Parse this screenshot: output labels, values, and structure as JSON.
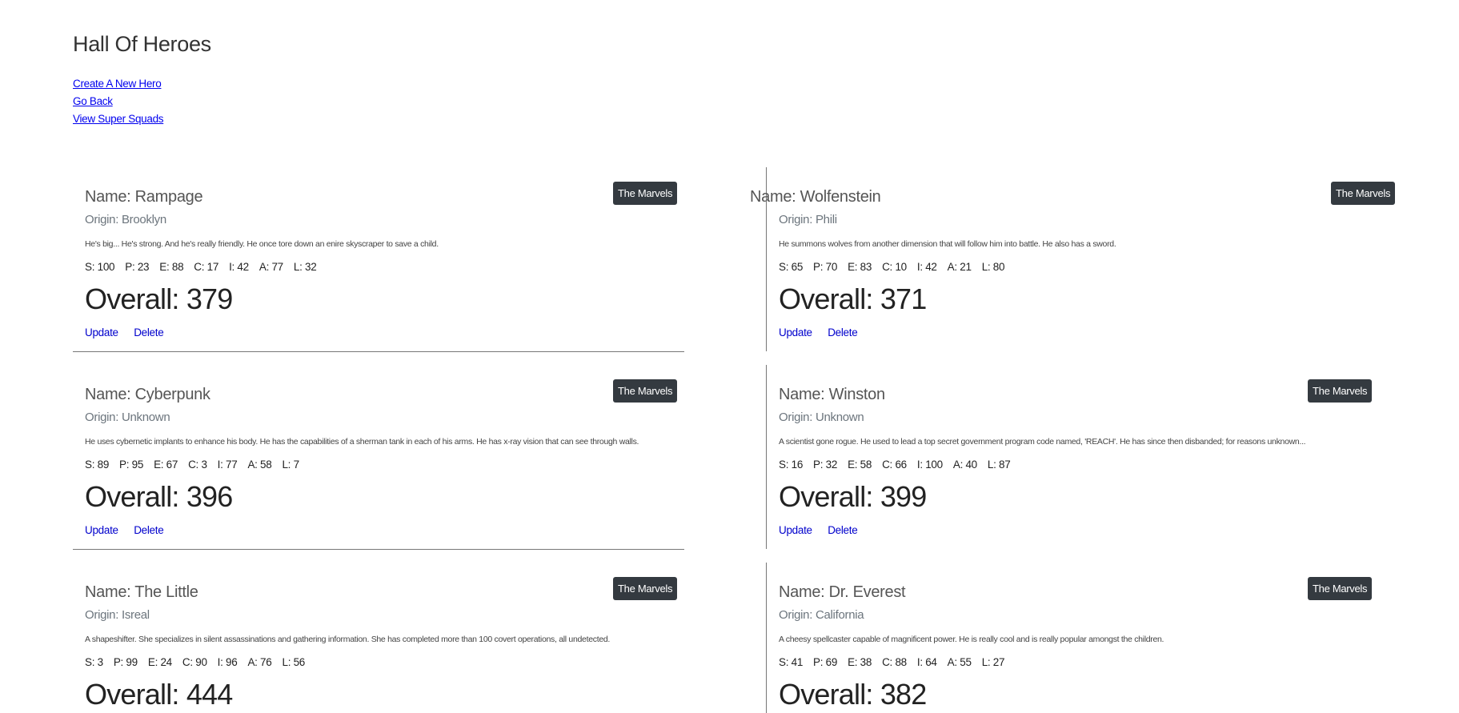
{
  "page": {
    "title": "Hall Of Heroes",
    "links": [
      "Create A New Hero",
      "Go Back",
      "View Super Squads"
    ]
  },
  "heroes": [
    {
      "name": "Name: Rampage",
      "origin": "Origin: Brooklyn",
      "description": "He's big... He's strong. And he's really friendly. He once tore down an enire skyscraper to save a child.",
      "stats": [
        "S: 100",
        "P: 23",
        "E: 88",
        "C: 17",
        "I: 42",
        "A: 77",
        "L: 32"
      ],
      "overall": "Overall: 379",
      "squad": "The Marvels",
      "update_label": "Update",
      "delete_label": "Delete"
    },
    {
      "name": "Name: Wolfenstein",
      "origin": "Origin: Phili",
      "description": "He summons wolves from another dimension that will follow him into battle. He also has a sword.",
      "stats": [
        "S: 65",
        "P: 70",
        "E: 83",
        "C: 10",
        "I: 42",
        "A: 21",
        "L: 80"
      ],
      "overall": "Overall: 371",
      "squad": "The Marvels",
      "update_label": "Update",
      "delete_label": "Delete"
    },
    {
      "name": "Name: Cyberpunk",
      "origin": "Origin: Unknown",
      "description": "He uses cybernetic implants to enhance his body. He has the capabilities of a sherman tank in each of his arms. He has x-ray vision that can see through walls.",
      "stats": [
        "S: 89",
        "P: 95",
        "E: 67",
        "C: 3",
        "I: 77",
        "A: 58",
        "L: 7"
      ],
      "overall": "Overall: 396",
      "squad": "The Marvels",
      "update_label": "Update",
      "delete_label": "Delete"
    },
    {
      "name": "Name: Winston",
      "origin": "Origin: Unknown",
      "description": "A scientist gone rogue. He used to lead a top secret government program code named, 'REACH'. He has since then disbanded; for reasons unknown...",
      "stats": [
        "S: 16",
        "P: 32",
        "E: 58",
        "C: 66",
        "I: 100",
        "A: 40",
        "L: 87"
      ],
      "overall": "Overall: 399",
      "squad": "The Marvels",
      "update_label": "Update",
      "delete_label": "Delete"
    },
    {
      "name": "Name: The Little",
      "origin": "Origin: Isreal",
      "description": "A shapeshifter. She specializes in silent assassinations and gathering information. She has completed more than 100 covert operations, all undetected.",
      "stats": [
        "S: 3",
        "P: 99",
        "E: 24",
        "C: 90",
        "I: 96",
        "A: 76",
        "L: 56"
      ],
      "overall": "Overall: 444",
      "squad": "The Marvels"
    },
    {
      "name": "Name: Dr. Everest",
      "origin": "Origin: California",
      "description": "A cheesy spellcaster capable of magnificent power. He is really cool and is really popular amongst the children.",
      "stats": [
        "S: 41",
        "P: 69",
        "E: 38",
        "C: 88",
        "I: 64",
        "A: 55",
        "L: 27"
      ],
      "overall": "Overall: 382",
      "squad": "The Marvels"
    }
  ]
}
